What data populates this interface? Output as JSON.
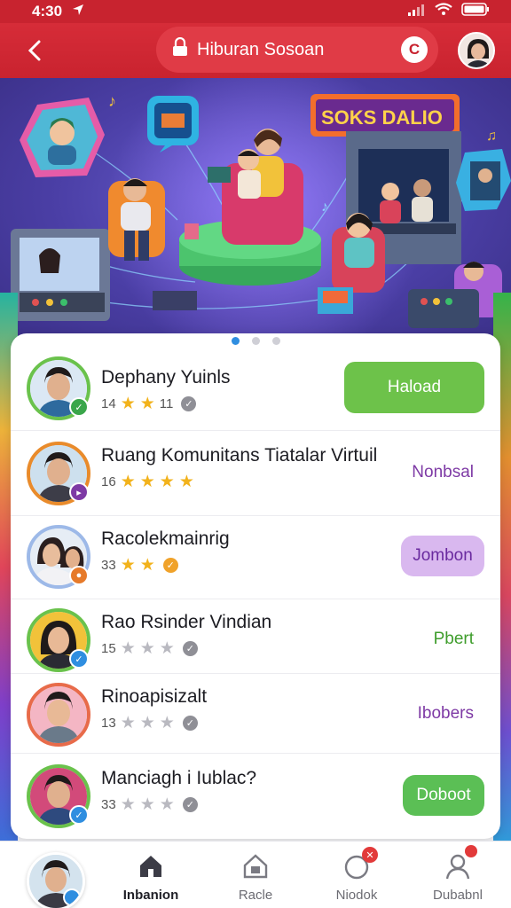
{
  "status": {
    "time": "4:30"
  },
  "header": {
    "title": "Hiburan Sosoan",
    "c_label": "C"
  },
  "hero": {
    "sign": "SOKS DALIO"
  },
  "list": [
    {
      "name": "Dephany Yuinls",
      "count": "14",
      "stars": 2,
      "trailing_num": "11",
      "action": "Haload",
      "action_style": "green",
      "ring": "#6ac24c",
      "badge": "#3aa64a"
    },
    {
      "name": "Ruang Komunitans Tiatalar Virtuil",
      "count": "16",
      "stars": 4,
      "action": "Nonbsal",
      "action_style": "text-purple",
      "ring": "#e98b2b",
      "badge": "#7e3aa5"
    },
    {
      "name": "Racolekmainrig",
      "count": "33",
      "stars": 2,
      "action": "Jombon",
      "action_style": "lavender",
      "ring": "#9db9e8",
      "badge": "#e67a2a"
    },
    {
      "name": "Rao Rsinder Vindian",
      "count": "15",
      "stars": 0,
      "action": "Pbert",
      "action_style": "text-green",
      "ring": "#6ac24c",
      "badge": "#2f8ee0"
    },
    {
      "name": "Rinoapisizalt",
      "count": "13",
      "stars": 0,
      "action": "Ibobers",
      "action_style": "text-purple",
      "ring": "#e86b4a",
      "badge": null
    },
    {
      "name": "Manciagh i Iublac?",
      "count": "33",
      "stars": 0,
      "action": "Doboot",
      "action_style": "green-small",
      "ring": "#6ac24c",
      "badge": "#2f8ee0"
    }
  ],
  "bottom_nav": [
    {
      "label": "Inbanion",
      "icon": "home-icon",
      "active": true
    },
    {
      "label": "Racle",
      "icon": "house-outline-icon",
      "active": false
    },
    {
      "label": "Niodok",
      "icon": "notification-icon",
      "active": false,
      "badge": ""
    },
    {
      "label": "Dubabnl",
      "icon": "profile-icon",
      "active": false,
      "badge": ""
    }
  ]
}
